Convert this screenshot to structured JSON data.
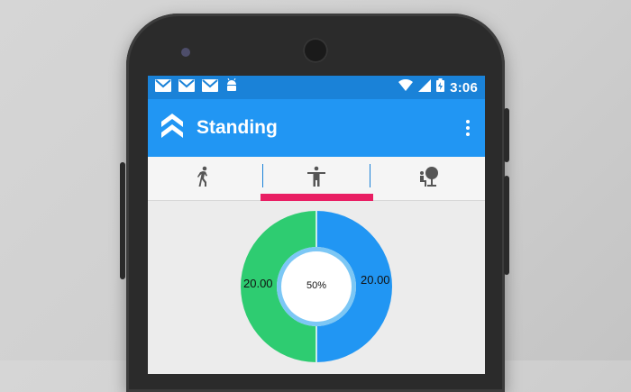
{
  "status_bar": {
    "time": "3:06",
    "left_icons": [
      "gmail-icon",
      "gmail-icon",
      "gmail-icon",
      "android-icon"
    ],
    "right_icons": [
      "wifi-icon",
      "signal-icon",
      "battery-icon"
    ]
  },
  "app_bar": {
    "title": "Standing",
    "logo_icon": "chevrons-up-logo-icon",
    "menu_icon": "more-vert-icon"
  },
  "tabs": [
    {
      "name": "walking",
      "icon": "walking-icon",
      "active": false
    },
    {
      "name": "standing",
      "icon": "standing-icon",
      "active": true
    },
    {
      "name": "sitting",
      "icon": "sitting-icon",
      "active": false
    }
  ],
  "chart_data": {
    "type": "pie",
    "donut": true,
    "slices": [
      {
        "label": "20.00",
        "value": 20.0,
        "color": "#2ecc71"
      },
      {
        "label": "20.00",
        "value": 20.0,
        "color": "#2196f3"
      }
    ],
    "center_label": "50%",
    "percent": 50
  },
  "colors": {
    "status_bar": "#1a82d8",
    "app_bar": "#2196f3",
    "tab_indicator": "#e91e63",
    "green": "#2ecc71",
    "blue": "#2196f3"
  }
}
